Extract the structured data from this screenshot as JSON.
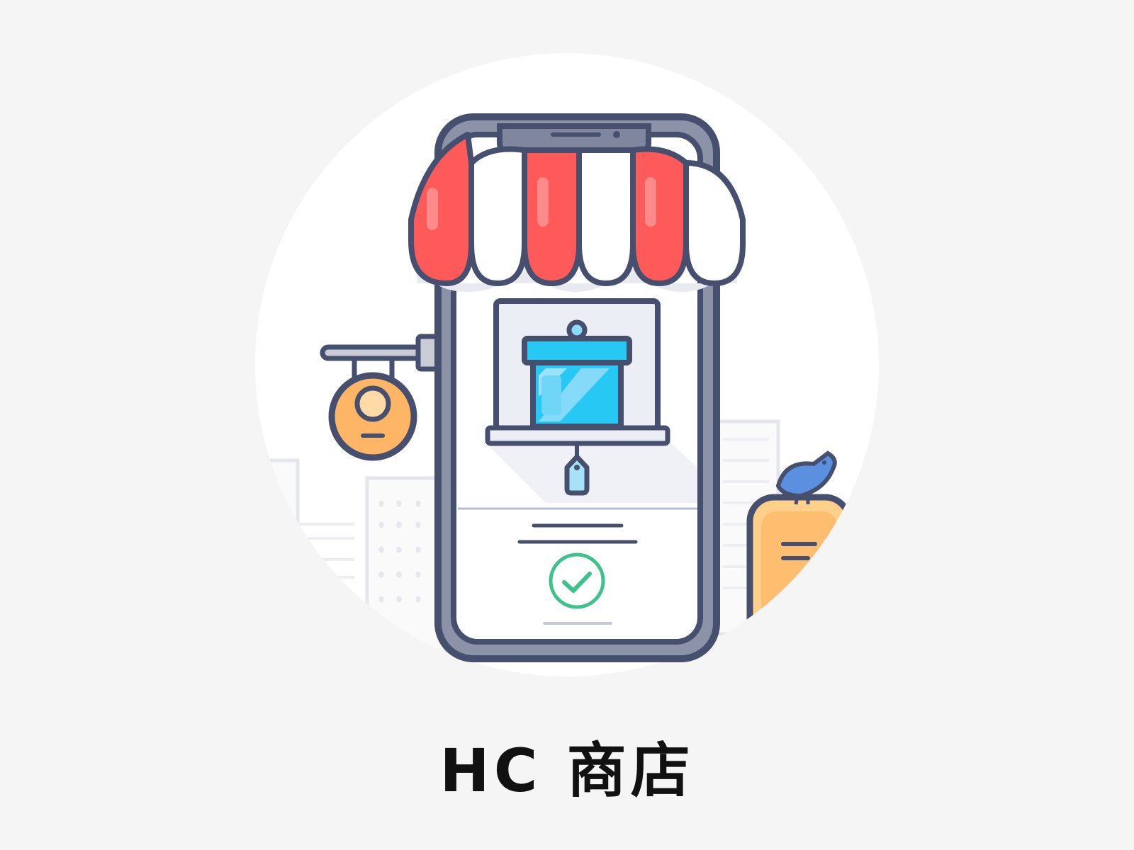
{
  "app": {
    "title": "HC 商店"
  },
  "illustration": {
    "subject": "storefront-phone-illustration",
    "icons": [
      "awning-icon",
      "gift-box-icon",
      "hanging-sign-icon",
      "price-tag-icon",
      "checkmark-icon",
      "bird-icon",
      "signboard-icon",
      "city-skyline-icon"
    ]
  },
  "colors": {
    "background": "#f5f5f5",
    "circle": "#ffffff",
    "outline": "#46506e",
    "awning_red": "#ff5a5a",
    "box_blue": "#28c8f5",
    "sign_orange": "#ffb566",
    "check_green": "#3cc28a"
  }
}
